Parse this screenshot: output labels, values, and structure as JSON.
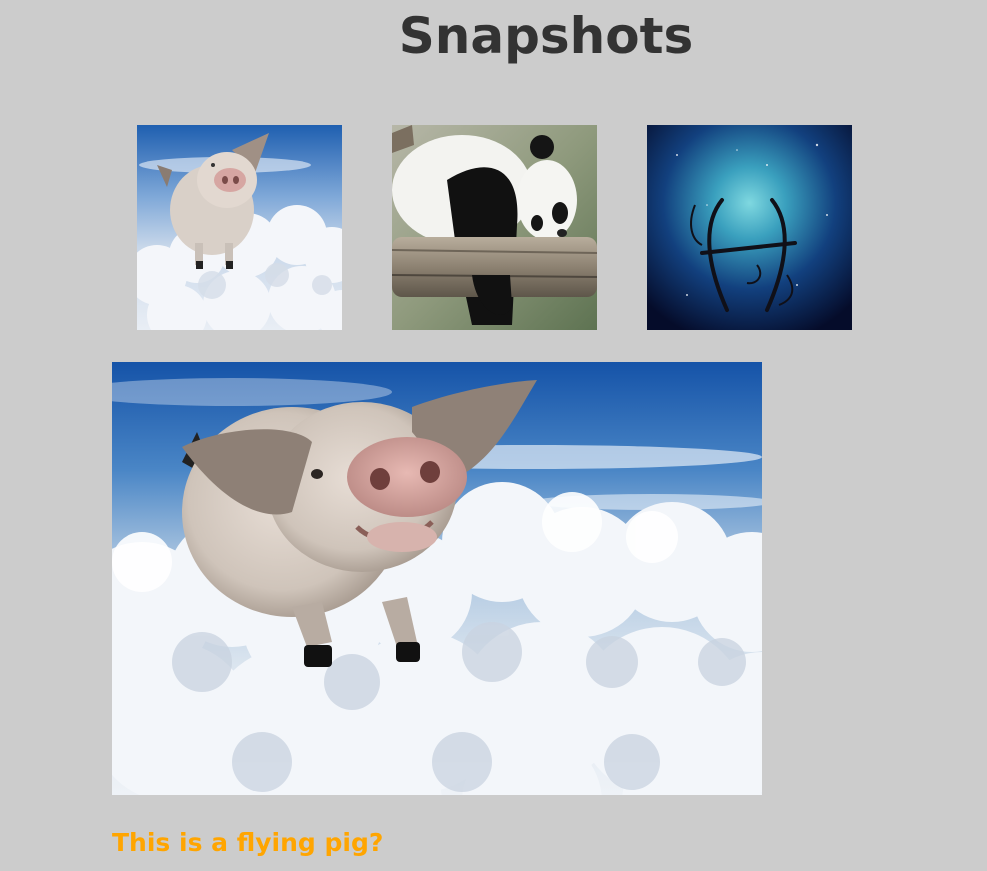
{
  "page": {
    "title": "Snapshots",
    "background": "#cccccc",
    "title_color": "#333333"
  },
  "gallery": {
    "thumbnails": [
      {
        "subject": "flying-pig"
      },
      {
        "subject": "sleeping-panda"
      },
      {
        "subject": "pisces-zodiac-symbol"
      }
    ],
    "selected_index": 0
  },
  "viewer": {
    "caption": "This is a flying pig?",
    "caption_color": "#ffa500"
  }
}
